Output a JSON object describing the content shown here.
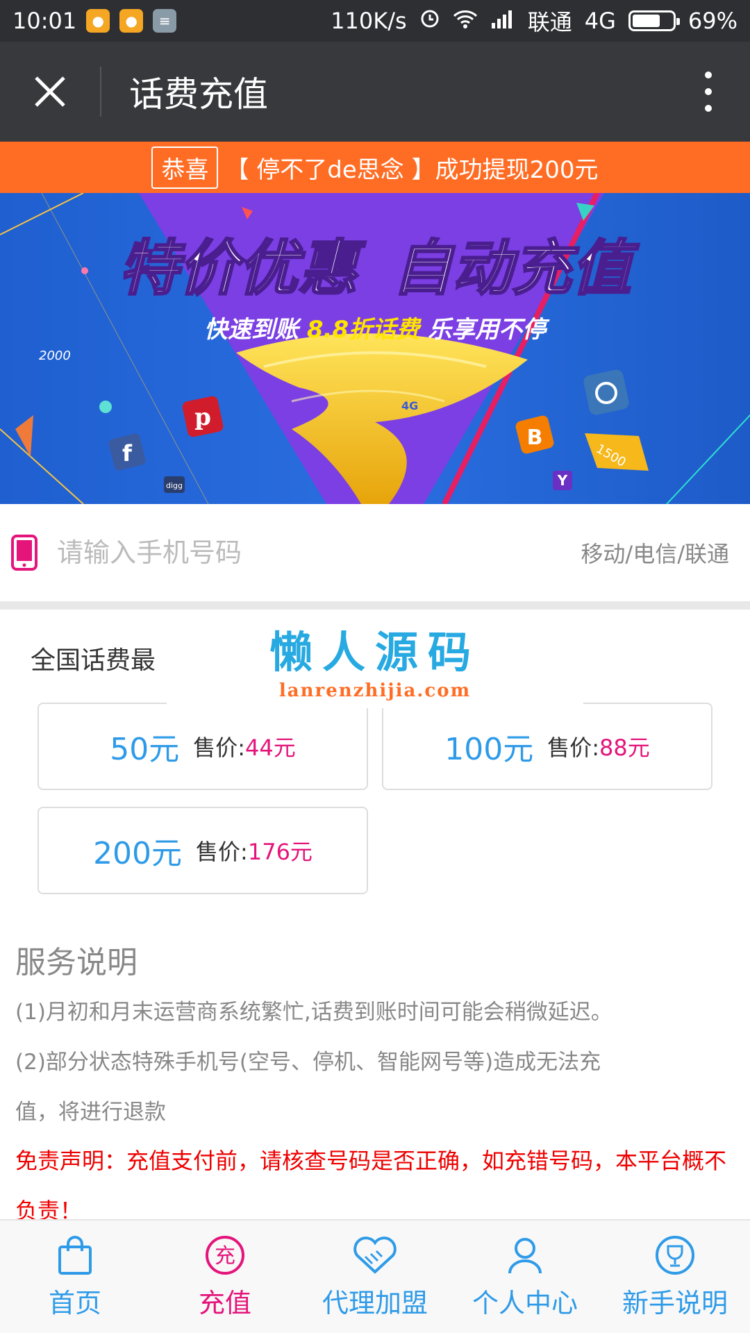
{
  "status_bar": {
    "time": "10:01",
    "speed": "110K/s",
    "carrier": "联通",
    "network": "4G",
    "battery": "69%",
    "battery_level": 0.69
  },
  "navbar": {
    "title": "话费充值",
    "close_icon": "close-icon",
    "more_icon": "more-vertical-icon"
  },
  "notice": {
    "tag": "恭喜",
    "text": "【 停不了de思念 】成功提现200元"
  },
  "banner": {
    "headline_1": "特价优惠",
    "headline_2": "自动充值",
    "sub_a": "快速到账",
    "sub_highlight": "8.8折话费",
    "sub_b": "乐享用不停",
    "tag_2000": "2000",
    "tag_1500": "1500",
    "tag_4g": "4G"
  },
  "phone_input": {
    "placeholder": "请输入手机号码",
    "carriers": "移动/电信/联通"
  },
  "section_title": "全国话费最",
  "watermark": {
    "cn": "懒人源码",
    "en": "lanrenzhijia.com"
  },
  "products": [
    {
      "face": "50元",
      "price_label": "售价:",
      "price": "44元"
    },
    {
      "face": "100元",
      "price_label": "售价:",
      "price": "88元"
    },
    {
      "face": "200元",
      "price_label": "售价:",
      "price": "176元"
    }
  ],
  "service": {
    "title": "服务说明",
    "item1": "(1)月初和月末运营商系统繁忙,话费到账时间可能会稍微延迟。",
    "item2_a": "(2)部分状态特殊手机号(空号、停机、智能网号等)造成无法充",
    "item2_b": "值，将进行退款",
    "disclaimer": "免责声明：充值支付前，请核查号码是否正确，如充错号码，本平台概不负责！"
  },
  "tabbar": [
    {
      "label": "首页",
      "icon": "shopping-bag-icon"
    },
    {
      "label": "充值",
      "icon": "recharge-icon",
      "icon_text": "充"
    },
    {
      "label": "代理加盟",
      "icon": "handshake-icon"
    },
    {
      "label": "个人中心",
      "icon": "user-icon"
    },
    {
      "label": "新手说明",
      "icon": "trophy-icon"
    }
  ],
  "colors": {
    "accent_blue": "#2f9be8",
    "accent_pink": "#e4147b",
    "notice_orange": "#ff6d25",
    "navbar_dark": "#38393d"
  }
}
